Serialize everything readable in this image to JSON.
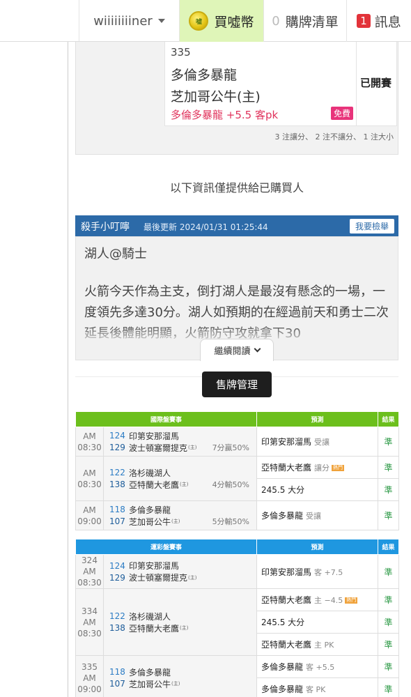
{
  "topbar": {
    "username": "wiiiiiiiiner",
    "buy_coins": "買噓幣",
    "coin_text": "嘘",
    "cart_count": "0",
    "cart_label": "購牌清單",
    "msg_count": "1",
    "msg_label": "訊息"
  },
  "game_card": {
    "number": "335",
    "away_team": "多倫多暴龍",
    "home_team": "芝加哥公牛(主)",
    "pick": "多倫多暴龍 +5.5 客pk",
    "free_tag": "免費",
    "status": "已開賽",
    "summary": "3 注讓分、 2 注不讓分、 1 注大小"
  },
  "notice": "以下資訊僅提供給已購買人",
  "analysis": {
    "author": "殺手小叮嚀",
    "updated": "最後更新 2024/01/31 01:25:44",
    "report_button": "我要檢舉",
    "title": "湖人@騎士",
    "body": "火箭今天作為主支，倒打湖人是最沒有懸念的一場，一度領先多達30分。湖人如預期的在經過前天和勇士二次延長後體能明顯，火箭防守攻就拿下30",
    "read_more": "繼續閱讀"
  },
  "manage_button": "售牌管理",
  "table1": {
    "headers": [
      "國際盤賽事",
      "預測",
      "結果"
    ],
    "games": [
      {
        "time": "AM 08:30",
        "away_num": "124",
        "away": "印第安那溜馬",
        "home_num": "129",
        "home": "波士頓塞爾提克",
        "home_mark": "(主)",
        "line": "7分贏50%",
        "preds": [
          {
            "text": "印第安那溜馬",
            "sub": "受讓",
            "hot": "",
            "result": "準"
          }
        ]
      },
      {
        "time": "AM 08:30",
        "away_num": "122",
        "away": "洛杉磯湖人",
        "home_num": "138",
        "home": "亞特蘭大老鷹",
        "home_mark": "(主)",
        "line": "4分輸50%",
        "preds": [
          {
            "text": "亞特蘭大老鷹",
            "sub": "讓分",
            "hot": "熱門",
            "result": "準"
          },
          {
            "text": "245.5 大分",
            "sub": "",
            "hot": "",
            "result": "準"
          }
        ]
      },
      {
        "time": "AM 09:00",
        "away_num": "118",
        "away": "多倫多暴龍",
        "home_num": "107",
        "home": "芝加哥公牛",
        "home_mark": "(主)",
        "line": "5分輸50%",
        "preds": [
          {
            "text": "多倫多暴龍",
            "sub": "受讓",
            "hot": "",
            "result": "準"
          }
        ]
      }
    ]
  },
  "table2": {
    "headers": [
      "運彩盤賽事",
      "預測",
      "結果"
    ],
    "games": [
      {
        "code": "324",
        "time": "AM 08:30",
        "away_num": "124",
        "away": "印第安那溜馬",
        "home_num": "129",
        "home": "波士頓塞爾提克",
        "home_mark": "(主)",
        "preds": [
          {
            "text": "印第安那溜馬",
            "sub": "客 +7.5",
            "hot": "",
            "result": "準"
          }
        ]
      },
      {
        "code": "334",
        "time": "AM 08:30",
        "away_num": "122",
        "away": "洛杉磯湖人",
        "home_num": "138",
        "home": "亞特蘭大老鷹",
        "home_mark": "(主)",
        "preds": [
          {
            "text": "亞特蘭大老鷹",
            "sub": "主 −4.5",
            "hot": "熱門",
            "result": "準"
          },
          {
            "text": "245.5 大分",
            "sub": "",
            "hot": "",
            "result": "準"
          },
          {
            "text": "亞特蘭大老鷹",
            "sub": "主 PK",
            "hot": "",
            "result": "準"
          }
        ]
      },
      {
        "code": "335",
        "time": "AM 09:00",
        "away_num": "118",
        "away": "多倫多暴龍",
        "home_num": "107",
        "home": "芝加哥公牛",
        "home_mark": "(主)",
        "preds": [
          {
            "text": "多倫多暴龍",
            "sub": "客 +5.5",
            "hot": "",
            "result": "準"
          },
          {
            "text": "多倫多暴龍",
            "sub": "客 PK",
            "hot": "",
            "result": "準"
          }
        ]
      }
    ]
  }
}
